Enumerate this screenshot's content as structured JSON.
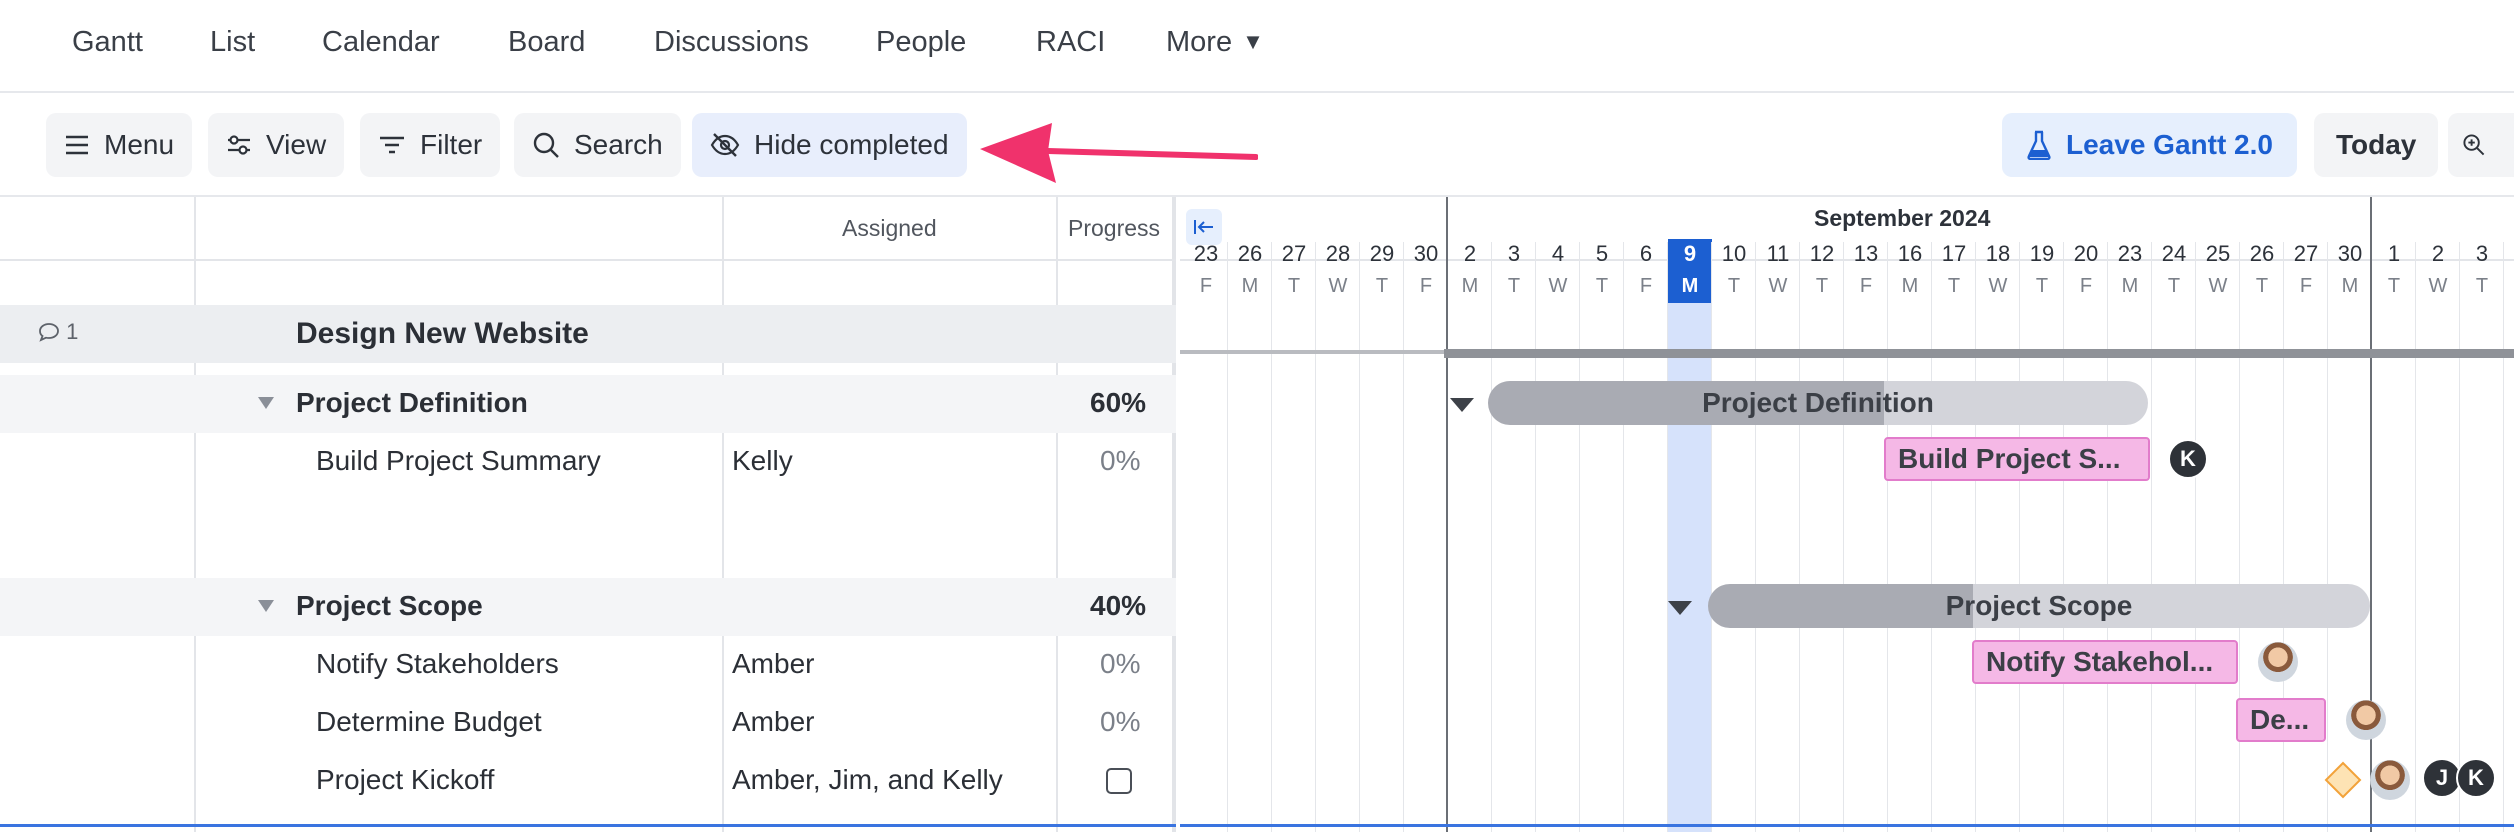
{
  "nav": {
    "tabs": [
      "Gantt",
      "List",
      "Calendar",
      "Board",
      "Discussions",
      "People",
      "RACI"
    ],
    "more_label": "More"
  },
  "toolbar": {
    "menu_label": "Menu",
    "view_label": "View",
    "filter_label": "Filter",
    "search_label": "Search",
    "hide_completed_label": "Hide completed",
    "leave_gantt_label": "Leave Gantt 2.0",
    "today_label": "Today"
  },
  "grid": {
    "columns": {
      "assigned": "Assigned",
      "progress": "Progress"
    },
    "rows": [
      {
        "name": "Design New Website",
        "kind": "project",
        "comments": "1",
        "assigned": "",
        "progress": ""
      },
      {
        "name": "Project Definition",
        "kind": "group",
        "assigned": "",
        "progress": "60%"
      },
      {
        "name": "Build Project Summary",
        "kind": "task",
        "assigned": "Kelly",
        "progress": "0%"
      },
      {
        "name": "Project Scope",
        "kind": "group",
        "assigned": "",
        "progress": "40%"
      },
      {
        "name": "Notify Stakeholders",
        "kind": "task",
        "assigned": "Amber",
        "progress": "0%"
      },
      {
        "name": "Determine Budget",
        "kind": "task",
        "assigned": "Amber",
        "progress": "0%"
      },
      {
        "name": "Project Kickoff",
        "kind": "milestone",
        "assigned": "Amber, Jim, and Kelly",
        "progress": "checkbox"
      }
    ]
  },
  "gantt": {
    "month_label": "September 2024",
    "days": [
      {
        "n": "23",
        "d": "F"
      },
      {
        "n": "26",
        "d": "M"
      },
      {
        "n": "27",
        "d": "T"
      },
      {
        "n": "28",
        "d": "W"
      },
      {
        "n": "29",
        "d": "T"
      },
      {
        "n": "30",
        "d": "F"
      },
      {
        "n": "2",
        "d": "M"
      },
      {
        "n": "3",
        "d": "T"
      },
      {
        "n": "4",
        "d": "W"
      },
      {
        "n": "5",
        "d": "T"
      },
      {
        "n": "6",
        "d": "F"
      },
      {
        "n": "9",
        "d": "M"
      },
      {
        "n": "10",
        "d": "T"
      },
      {
        "n": "11",
        "d": "W"
      },
      {
        "n": "12",
        "d": "T"
      },
      {
        "n": "13",
        "d": "F"
      },
      {
        "n": "16",
        "d": "M"
      },
      {
        "n": "17",
        "d": "T"
      },
      {
        "n": "18",
        "d": "W"
      },
      {
        "n": "19",
        "d": "T"
      },
      {
        "n": "20",
        "d": "F"
      },
      {
        "n": "23",
        "d": "M"
      },
      {
        "n": "24",
        "d": "T"
      },
      {
        "n": "25",
        "d": "W"
      },
      {
        "n": "26",
        "d": "T"
      },
      {
        "n": "27",
        "d": "F"
      },
      {
        "n": "30",
        "d": "M"
      },
      {
        "n": "1",
        "d": "T"
      },
      {
        "n": "2",
        "d": "W"
      },
      {
        "n": "3",
        "d": "T"
      }
    ],
    "today_day": "9",
    "bars": [
      {
        "label": "Project Definition",
        "kind": "summary"
      },
      {
        "label": "Build Project S...",
        "kind": "task",
        "assignee_initial": "K"
      },
      {
        "label": "Project Scope",
        "kind": "summary"
      },
      {
        "label": "Notify Stakehol...",
        "kind": "task"
      },
      {
        "label": "De...",
        "kind": "task"
      }
    ],
    "kickoff_assignees": [
      "J",
      "K"
    ]
  }
}
